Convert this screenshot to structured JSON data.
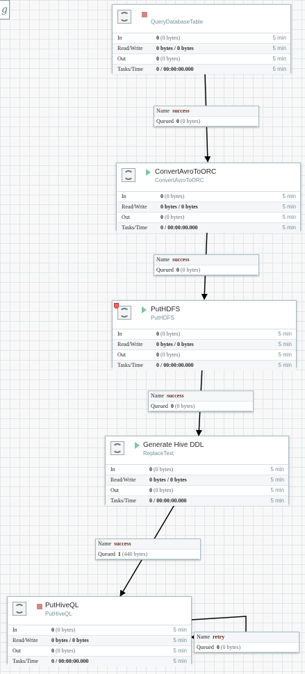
{
  "canvas": {
    "corner_tag": "g"
  },
  "processors": [
    {
      "name": "",
      "type": "QueryDatabaseTable",
      "state": "stopped",
      "stats": [
        {
          "label": "In",
          "value": "0",
          "extra": "(0 bytes)",
          "time": "5 min"
        },
        {
          "label": "Read/Write",
          "value": "0 bytes / 0 bytes",
          "extra": "",
          "time": "5 min"
        },
        {
          "label": "Out",
          "value": "0",
          "extra": "(0 bytes)",
          "time": "5 min"
        },
        {
          "label": "Tasks/Time",
          "value": "0 / 00:00:00.000",
          "extra": "",
          "time": "5 min"
        }
      ]
    },
    {
      "name": "ConvertAvroToORC",
      "type": "ConvertAvroToORC",
      "state": "running",
      "stats": [
        {
          "label": "In",
          "value": "0",
          "extra": "(0 bytes)",
          "time": "5 min"
        },
        {
          "label": "Read/Write",
          "value": "0 bytes / 0 bytes",
          "extra": "",
          "time": "5 min"
        },
        {
          "label": "Out",
          "value": "0",
          "extra": "(0 bytes)",
          "time": "5 min"
        },
        {
          "label": "Tasks/Time",
          "value": "0 / 00:00:00.000",
          "extra": "",
          "time": "5 min"
        }
      ]
    },
    {
      "name": "PutHDFS",
      "type": "PutHDFS",
      "state": "running",
      "stats": [
        {
          "label": "In",
          "value": "0",
          "extra": "(0 bytes)",
          "time": "5 min"
        },
        {
          "label": "Read/Write",
          "value": "0 bytes / 0 bytes",
          "extra": "",
          "time": "5 min"
        },
        {
          "label": "Out",
          "value": "0",
          "extra": "(0 bytes)",
          "time": "5 min"
        },
        {
          "label": "Tasks/Time",
          "value": "0 / 00:00:00.000",
          "extra": "",
          "time": "5 min"
        }
      ]
    },
    {
      "name": "Generate Hive DDL",
      "type": "ReplaceText",
      "state": "running",
      "stats": [
        {
          "label": "In",
          "value": "0",
          "extra": "(0 bytes)",
          "time": "5 min"
        },
        {
          "label": "Read/Write",
          "value": "0 bytes / 0 bytes",
          "extra": "",
          "time": "5 min"
        },
        {
          "label": "Out",
          "value": "0",
          "extra": "(0 bytes)",
          "time": "5 min"
        },
        {
          "label": "Tasks/Time",
          "value": "0 / 00:00:00.000",
          "extra": "",
          "time": "5 min"
        }
      ]
    },
    {
      "name": "PutHiveQL",
      "type": "PutHiveQL",
      "state": "stopped",
      "stats": [
        {
          "label": "In",
          "value": "0",
          "extra": "(0 bytes)",
          "time": "5 min"
        },
        {
          "label": "Read/Write",
          "value": "0 bytes / 0 bytes",
          "extra": "",
          "time": "5 min"
        },
        {
          "label": "Out",
          "value": "0",
          "extra": "(0 bytes)",
          "time": "5 min"
        },
        {
          "label": "Tasks/Time",
          "value": "0 / 00:00:00.000",
          "extra": "",
          "time": "5 min"
        }
      ]
    }
  ],
  "connections": [
    {
      "name_label": "Name",
      "name": "success",
      "queued_label": "Queued",
      "count": "0",
      "size": "(0 bytes)"
    },
    {
      "name_label": "Name",
      "name": "success",
      "queued_label": "Queued",
      "count": "0",
      "size": "(0 bytes)"
    },
    {
      "name_label": "Name",
      "name": "success",
      "queued_label": "Queued",
      "count": "0",
      "size": "(0 bytes)"
    },
    {
      "name_label": "Name",
      "name": "success",
      "queued_label": "Queued",
      "count": "1",
      "size": "(440 bytes)"
    },
    {
      "name_label": "Name",
      "name": "retry",
      "queued_label": "Queued",
      "count": "0",
      "size": "(0 bytes)"
    }
  ]
}
